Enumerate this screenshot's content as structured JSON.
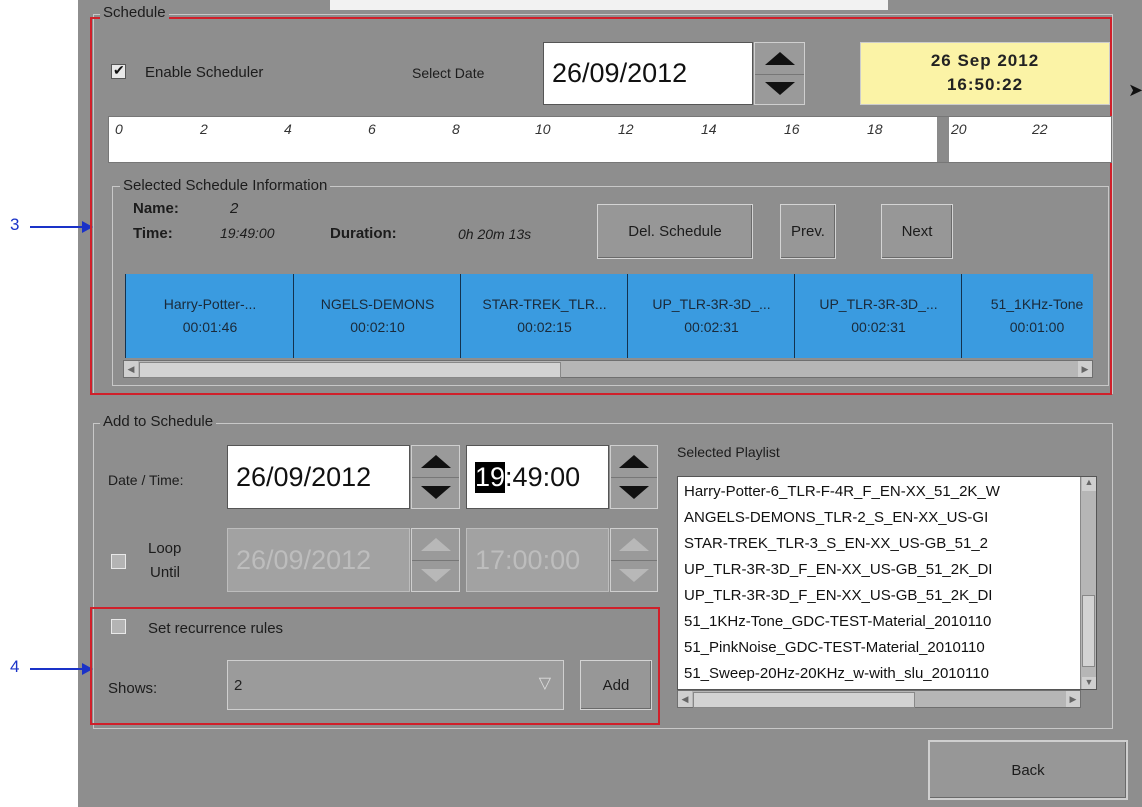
{
  "schedule": {
    "legend": "Schedule",
    "enable_label": "Enable Scheduler",
    "enable_checked": true,
    "select_date_label": "Select Date",
    "select_date_value": "26/09/2012",
    "clock_date": "26 Sep 2012",
    "clock_time": "16:50:22",
    "timeline_ticks": [
      "0",
      "2",
      "4",
      "6",
      "8",
      "10",
      "12",
      "14",
      "16",
      "18",
      "20",
      "22"
    ]
  },
  "selected_info": {
    "legend": "Selected Schedule Information",
    "name_label": "Name:",
    "name_value": "2",
    "time_label": "Time:",
    "time_value": "19:49:00",
    "duration_label": "Duration:",
    "duration_value": "0h 20m 13s",
    "del_button": "Del. Schedule",
    "prev_button": "Prev.",
    "next_button": "Next",
    "tiles": [
      {
        "title": "Harry-Potter-...",
        "duration": "00:01:46"
      },
      {
        "title": "NGELS-DEMONS",
        "duration": "00:02:10"
      },
      {
        "title": "STAR-TREK_TLR...",
        "duration": "00:02:15"
      },
      {
        "title": "UP_TLR-3R-3D_...",
        "duration": "00:02:31"
      },
      {
        "title": "UP_TLR-3R-3D_...",
        "duration": "00:02:31"
      },
      {
        "title": "51_1KHz-Tone",
        "duration": "00:01:00"
      }
    ]
  },
  "add": {
    "legend": "Add to Schedule",
    "datetime_label": "Date / Time:",
    "date_value": "26/09/2012",
    "time_hour": "19",
    "time_rest": ":49:00",
    "loop_label_1": "Loop",
    "loop_label_2": "Until",
    "loop_checked": false,
    "loop_date": "26/09/2012",
    "loop_time": "17:00:00",
    "recurrence_label": "Set recurrence rules",
    "recurrence_checked": false,
    "shows_label": "Shows:",
    "shows_value": "2",
    "add_button": "Add"
  },
  "playlist": {
    "label": "Selected Playlist",
    "items": [
      "Harry-Potter-6_TLR-F-4R_F_EN-XX_51_2K_W",
      "ANGELS-DEMONS_TLR-2_S_EN-XX_US-GI",
      "STAR-TREK_TLR-3_S_EN-XX_US-GB_51_2",
      "UP_TLR-3R-3D_F_EN-XX_US-GB_51_2K_DI",
      "UP_TLR-3R-3D_F_EN-XX_US-GB_51_2K_DI",
      "51_1KHz-Tone_GDC-TEST-Material_2010110",
      "51_PinkNoise_GDC-TEST-Material_2010110",
      "51_Sweep-20Hz-20KHz_w-with_slu_2010110"
    ]
  },
  "footer": {
    "back_button": "Back"
  },
  "annotations": {
    "marker_3": "3",
    "marker_4": "4"
  },
  "colors": {
    "highlight": "#d0202a",
    "tile": "#3a9be0",
    "clock_bg": "#fbf3a6",
    "panel": "#8e8e8e",
    "marker": "#1a32c8"
  }
}
